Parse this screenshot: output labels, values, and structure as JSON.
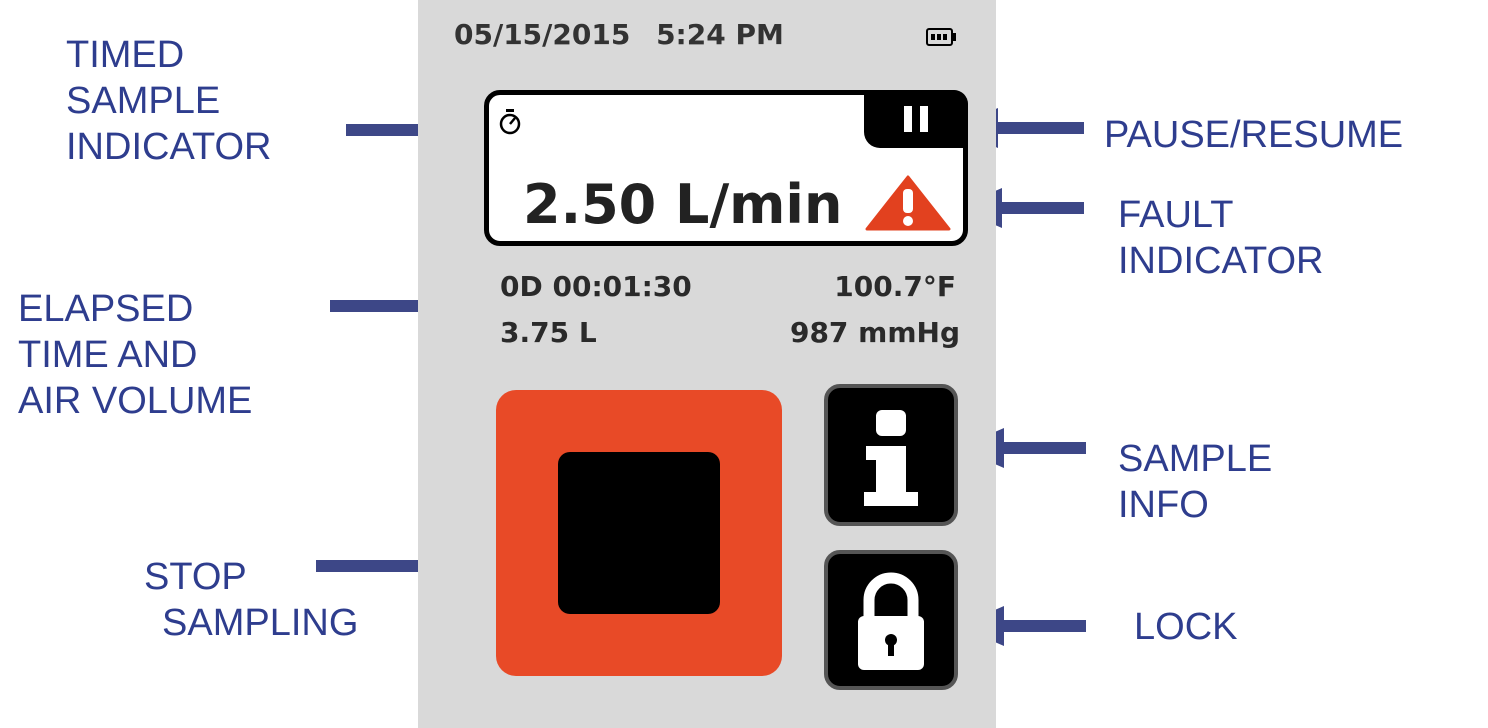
{
  "callouts": {
    "timed_sample": [
      "TIMED",
      "SAMPLE",
      "INDICATOR"
    ],
    "elapsed": [
      "ELAPSED",
      "TIME AND",
      "AIR VOLUME"
    ],
    "stop": [
      "STOP",
      "SAMPLING"
    ],
    "pause": [
      "PAUSE/RESUME"
    ],
    "fault": [
      "FAULT",
      "INDICATOR"
    ],
    "sample_info": [
      "SAMPLE",
      "INFO"
    ],
    "lock": [
      "LOCK"
    ]
  },
  "device": {
    "date": "05/15/2015",
    "time": "5:24 PM",
    "flow_rate": "2.50 L/min",
    "elapsed_time": "0D 00:01:30",
    "temperature": "100.7°F",
    "volume": "3.75 L",
    "pressure": "987 mmHg"
  },
  "icons": {
    "battery": "battery-icon",
    "timer": "stopwatch-icon",
    "pause": "pause-icon",
    "fault": "warning-triangle-icon",
    "info": "info-icon",
    "lock": "padlock-icon",
    "stop": "stop-icon"
  },
  "colors": {
    "callout_text": "#2e3d8e",
    "arrow": "#3d4787",
    "stop_button": "#e84a27",
    "fault": "#e2411f",
    "screen_bg": "#d9d9d9"
  }
}
